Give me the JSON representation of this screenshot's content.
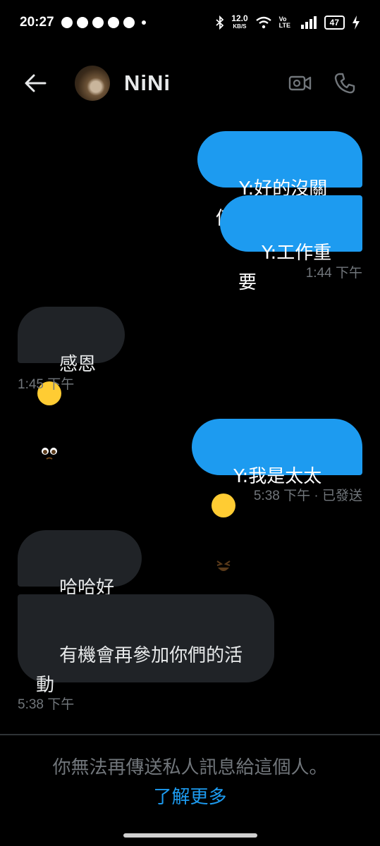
{
  "status_bar": {
    "time": "20:27",
    "net_speed_value": "12.0",
    "net_speed_unit": "KB/S",
    "volte": "Vo LTE",
    "battery": "47"
  },
  "header": {
    "contact_name": "NiNi"
  },
  "messages": [
    {
      "direction": "out",
      "text": "Y:好的沒關係"
    },
    {
      "direction": "out",
      "text": "Y:工作重要"
    },
    {
      "direction": "out-time",
      "text": "1:44 下午"
    },
    {
      "direction": "in",
      "text": "感恩",
      "emoji": "pleading-face-icon"
    },
    {
      "direction": "in-time",
      "text": "1:45 下午"
    },
    {
      "direction": "out",
      "text": "Y:我是太太",
      "emoji": "rolling-laughing-icon"
    },
    {
      "direction": "out-time",
      "text": "5:38 下午 · 已發送"
    },
    {
      "direction": "in",
      "text": "哈哈好喔"
    },
    {
      "direction": "in",
      "text": "有機會再參加你們的活\n動"
    },
    {
      "direction": "in-time",
      "text": "5:38 下午"
    }
  ],
  "footer": {
    "notice": "你無法再傳送私人訊息給這個人。",
    "learn_more": "了解更多"
  },
  "colors": {
    "accent": "#1d9bf0",
    "incoming_bubble": "#202327",
    "background": "#000000",
    "muted_text": "#71767b"
  }
}
